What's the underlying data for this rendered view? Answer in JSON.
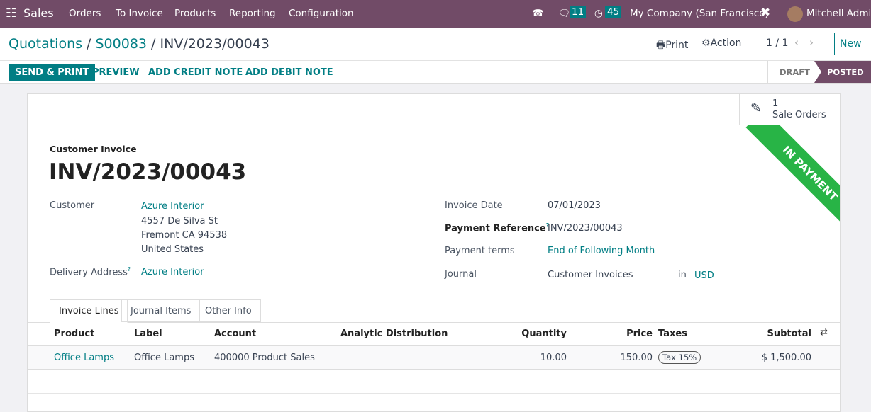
{
  "nav": {
    "app": "Sales",
    "menu": [
      "Orders",
      "To Invoice",
      "Products",
      "Reporting",
      "Configuration"
    ],
    "messages_count": "11",
    "activities_count": "45",
    "company": "My Company (San Francisco)",
    "user": "Mitchell Admin"
  },
  "breadcrumb": {
    "root": "Quotations",
    "parent": "S00083",
    "current": "INV/2023/00043"
  },
  "control": {
    "print": "Print",
    "action": "Action",
    "pager": "1 / 1",
    "new": "New"
  },
  "buttons": {
    "send_print": "SEND & PRINT",
    "preview": "PREVIEW",
    "credit": "ADD CREDIT NOTE",
    "debit": "ADD DEBIT NOTE"
  },
  "status": {
    "draft": "DRAFT",
    "posted": "POSTED"
  },
  "smart": {
    "count": "1",
    "label": "Sale Orders"
  },
  "ribbon": {
    "text": "IN PAYMENT",
    "color": "#28b446"
  },
  "form": {
    "type": "Customer Invoice",
    "name": "INV/2023/00043",
    "customer_label": "Customer",
    "customer": "Azure Interior",
    "addr1": "4557 De Silva St",
    "addr2": "Fremont CA 94538",
    "addr3": "United States",
    "delivery_label": "Delivery Address",
    "delivery": "Azure Interior",
    "date_label": "Invoice Date",
    "date": "07/01/2023",
    "payref_label": "Payment Reference",
    "payref": "INV/2023/00043",
    "terms_label": "Payment terms",
    "terms": "End of Following Month",
    "journal_label": "Journal",
    "journal": "Customer Invoices",
    "in": "in",
    "currency": "USD"
  },
  "tabs": [
    "Invoice Lines",
    "Journal Items",
    "Other Info"
  ],
  "table": {
    "headers": {
      "product": "Product",
      "label": "Label",
      "account": "Account",
      "analytic": "Analytic Distribution",
      "qty": "Quantity",
      "price": "Price",
      "taxes": "Taxes",
      "subtotal": "Subtotal"
    },
    "rows": [
      {
        "product": "Office Lamps",
        "label": "Office Lamps",
        "account": "400000 Product Sales",
        "qty": "10.00",
        "price": "150.00",
        "tax": "Tax 15%",
        "subtotal": "$ 1,500.00"
      }
    ]
  }
}
